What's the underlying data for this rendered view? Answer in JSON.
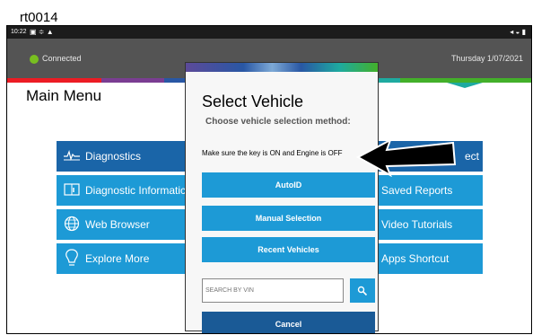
{
  "frame_label": "rt0014",
  "statusbar": {
    "time": "10:22",
    "left_icons": "▣ ≑ ▲",
    "right_icons": "◂ ◒ ▮"
  },
  "header": {
    "connection": "Connected",
    "date": "Thursday 1/07/2021"
  },
  "main": {
    "title": "Main Menu"
  },
  "tiles_left": [
    {
      "label": "Diagnostics",
      "icon": "pulse-icon"
    },
    {
      "label": "Diagnostic Informatic",
      "icon": "book-icon"
    },
    {
      "label": "Web Browser",
      "icon": "globe-icon"
    },
    {
      "label": "Explore More",
      "icon": "bulb-icon"
    }
  ],
  "tiles_right": [
    {
      "label": "ect"
    },
    {
      "label": "Saved Reports"
    },
    {
      "label": "Video Tutorials"
    },
    {
      "label": "Apps Shortcut"
    }
  ],
  "modal": {
    "title": "Select Vehicle",
    "subtitle": "Choose vehicle selection method:",
    "note": "Make sure the key is ON and Engine is OFF",
    "buttons": [
      "AutoID",
      "Manual Selection",
      "Recent Vehicles"
    ],
    "vin_placeholder": "SEARCH BY VIN",
    "cancel": "Cancel"
  },
  "nav": {
    "recents": "|||",
    "home": "○",
    "back": "‹"
  },
  "colors": {
    "accent": "#1d9ad6",
    "dark_tile": "#1a65a8",
    "cancel": "#1a5a96",
    "connected": "#78be20"
  }
}
